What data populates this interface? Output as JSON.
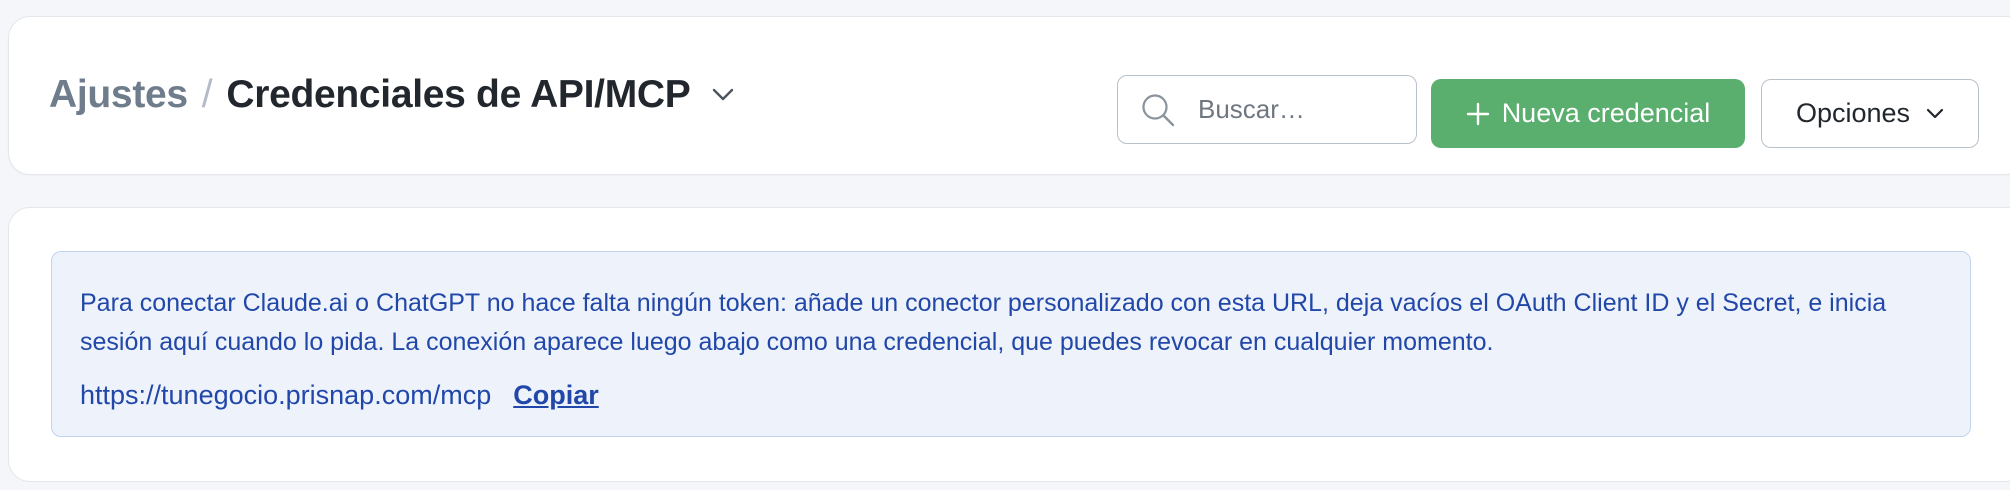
{
  "header": {
    "breadcrumb_parent": "Ajustes",
    "breadcrumb_separator": "/",
    "page_title": "Credenciales de API/MCP",
    "title_dropdown_icon": "chevron-down-icon",
    "search": {
      "placeholder": "Buscar…",
      "value": "",
      "icon": "search-icon"
    },
    "new_button": {
      "icon": "plus-icon",
      "label": "Nueva credencial"
    },
    "options_button": {
      "label": "Opciones",
      "icon": "chevron-down-icon"
    }
  },
  "info": {
    "message": "Para conectar Claude.ai o ChatGPT no hace falta ningún token: añade un conector personalizado con esta URL, deja vacíos el OAuth Client ID y el Secret, e inicia sesión aquí cuando lo pida. La conexión aparece luego abajo como una credencial, que puedes revocar en cualquier momento.",
    "url": "https://tunegocio.prisnap.com/mcp",
    "copy_label": "Copiar"
  },
  "colors": {
    "page_background": "#f4f6f9",
    "primary_button": "#5aae6e",
    "info_background": "#edf2fb",
    "info_border": "#c0d4ee",
    "info_text": "#2147a8",
    "breadcrumb_parent": "#6e7c8c",
    "title_text": "#22272e"
  }
}
